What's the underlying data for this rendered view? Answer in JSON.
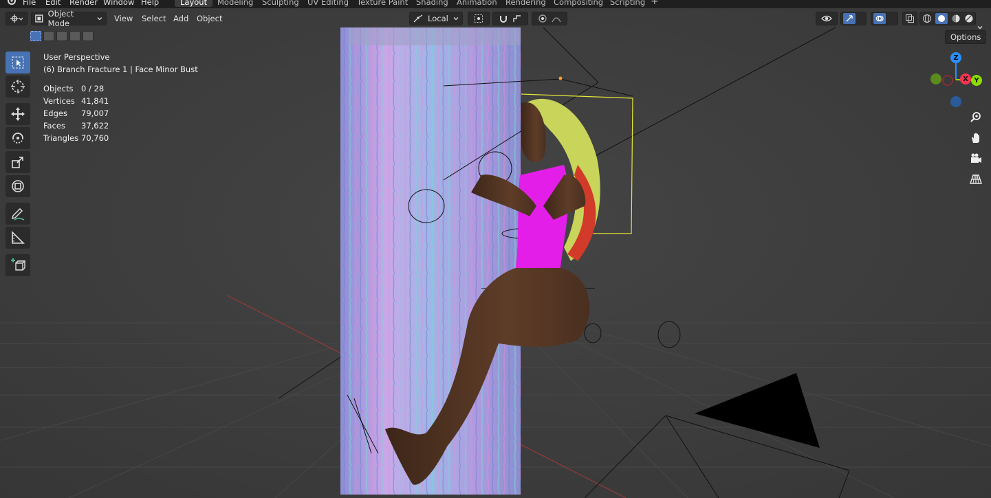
{
  "menu": {
    "items": [
      "File",
      "Edit",
      "Render",
      "Window",
      "Help"
    ]
  },
  "workspaces": {
    "tabs": [
      "Layout",
      "Modeling",
      "Sculpting",
      "UV Editing",
      "Texture Paint",
      "Shading",
      "Animation",
      "Rendering",
      "Compositing",
      "Scripting"
    ],
    "active": "Layout",
    "add_label": "+"
  },
  "header": {
    "mode": "Object Mode",
    "view": "View",
    "select": "Select",
    "add": "Add",
    "object": "Object",
    "orientation": "Local",
    "options": "Options"
  },
  "overlay": {
    "view_name": "User Perspective",
    "active_object": "(6) Branch Fracture 1 | Face Minor Bust"
  },
  "stats": [
    {
      "label": "Objects",
      "value": "0 / 28"
    },
    {
      "label": "Vertices",
      "value": "41,841"
    },
    {
      "label": "Edges",
      "value": "79,007"
    },
    {
      "label": "Faces",
      "value": "37,622"
    },
    {
      "label": "Triangles",
      "value": "70,760"
    }
  ],
  "gizmo": {
    "z": "Z",
    "x": "X",
    "y": "Y"
  },
  "colors": {
    "accent": "#4772b3",
    "x_axis": "#ff3352",
    "y_axis": "#8bdc00",
    "z_axis": "#2890ff",
    "skin": "#5a3a26",
    "top": "#e31ee8",
    "trunk": "#a9a9e6"
  },
  "icons": {
    "editor_type": "editor-type-icon",
    "select_box": "select-box-icon",
    "cursor": "cursor-icon",
    "move": "move-icon",
    "rotate": "rotate-icon",
    "scale": "scale-icon",
    "transform": "transform-icon",
    "annotate": "annotate-icon",
    "measure": "measure-icon",
    "add_cube": "add-cube-icon",
    "zoom": "zoom-icon",
    "hand": "hand-icon",
    "camera": "camera-icon",
    "grid": "grid-icon"
  }
}
